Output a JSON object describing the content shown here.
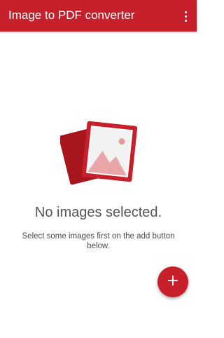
{
  "app": {
    "title": "Image to PDF converter",
    "accent_color": "#c8202a"
  },
  "toolbar": {
    "overflow_icon": "more-vert-icon"
  },
  "empty_state": {
    "icon": "image-stack-icon",
    "title": "No images selected.",
    "subtitle": "Select some images first on the add button below."
  },
  "fab": {
    "icon": "plus-icon",
    "label": "+"
  }
}
